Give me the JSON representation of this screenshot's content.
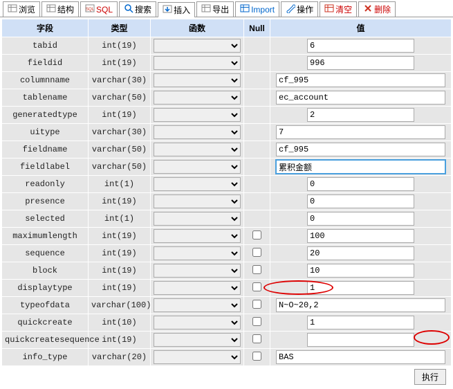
{
  "tabs": [
    {
      "label": "浏览",
      "icon": "table-icon",
      "iconColor": "#888"
    },
    {
      "label": "结构",
      "icon": "table-icon",
      "iconColor": "#888"
    },
    {
      "label": "SQL",
      "icon": "sql-icon",
      "iconColor": "#c32",
      "labelClass": "red"
    },
    {
      "label": "搜索",
      "icon": "search-icon",
      "iconColor": "#06c"
    },
    {
      "label": "插入",
      "icon": "insert-icon",
      "iconColor": "#06c",
      "labelClass": "",
      "active": true
    },
    {
      "label": "导出",
      "icon": "table-icon",
      "iconColor": "#888"
    },
    {
      "label": "Import",
      "icon": "table-icon",
      "iconColor": "#06c",
      "labelClass": "blue"
    },
    {
      "label": "操作",
      "icon": "wrench-icon",
      "iconColor": "#06c"
    },
    {
      "label": "清空",
      "icon": "table-icon",
      "iconColor": "#c32",
      "labelClass": "red"
    },
    {
      "label": "删除",
      "icon": "delete-icon",
      "iconColor": "#c32",
      "labelClass": "red"
    }
  ],
  "headers": {
    "field": "字段",
    "type": "类型",
    "func": "函数",
    "null": "Null",
    "value": "值"
  },
  "rows": [
    {
      "field": "tabid",
      "type": "int(19)",
      "allowNull": false,
      "value": "6"
    },
    {
      "field": "fieldid",
      "type": "int(19)",
      "allowNull": false,
      "value": "996"
    },
    {
      "field": "columnname",
      "type": "varchar(30)",
      "allowNull": false,
      "value": "cf_995"
    },
    {
      "field": "tablename",
      "type": "varchar(50)",
      "allowNull": false,
      "value": "ec_account"
    },
    {
      "field": "generatedtype",
      "type": "int(19)",
      "allowNull": false,
      "value": "2"
    },
    {
      "field": "uitype",
      "type": "varchar(30)",
      "allowNull": false,
      "value": "7"
    },
    {
      "field": "fieldname",
      "type": "varchar(50)",
      "allowNull": false,
      "value": "cf_995"
    },
    {
      "field": "fieldlabel",
      "type": "varchar(50)",
      "allowNull": false,
      "value": "累积金额",
      "highlight": true
    },
    {
      "field": "readonly",
      "type": "int(1)",
      "allowNull": false,
      "value": "0"
    },
    {
      "field": "presence",
      "type": "int(19)",
      "allowNull": false,
      "value": "0"
    },
    {
      "field": "selected",
      "type": "int(1)",
      "allowNull": false,
      "value": "0"
    },
    {
      "field": "maximumlength",
      "type": "int(19)",
      "allowNull": true,
      "value": "100"
    },
    {
      "field": "sequence",
      "type": "int(19)",
      "allowNull": true,
      "value": "20"
    },
    {
      "field": "block",
      "type": "int(19)",
      "allowNull": true,
      "value": "10"
    },
    {
      "field": "displaytype",
      "type": "int(19)",
      "allowNull": true,
      "value": "1"
    },
    {
      "field": "typeofdata",
      "type": "varchar(100)",
      "allowNull": true,
      "value": "N~O~20,2"
    },
    {
      "field": "quickcreate",
      "type": "int(10)",
      "allowNull": true,
      "value": "1"
    },
    {
      "field": "quickcreatesequence",
      "type": "int(19)",
      "allowNull": true,
      "value": ""
    },
    {
      "field": "info_type",
      "type": "varchar(20)",
      "allowNull": true,
      "value": "BAS"
    }
  ],
  "footer": {
    "submit": "执行"
  }
}
